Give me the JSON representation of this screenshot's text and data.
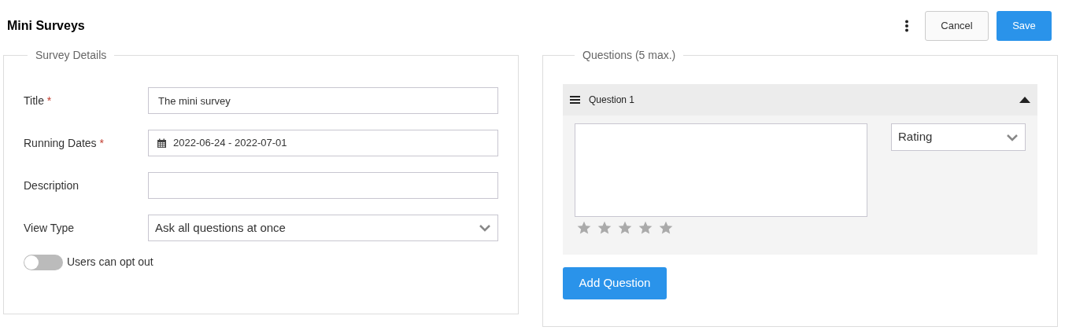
{
  "page_title": "Mini Surveys",
  "actions": {
    "cancel": "Cancel",
    "save": "Save"
  },
  "details": {
    "legend": "Survey Details",
    "fields": [
      {
        "kind": "text",
        "label": "Title",
        "required_mark": "*",
        "value": "The mini survey"
      },
      {
        "kind": "date",
        "label": "Running Dates",
        "required_mark": "*",
        "value": "2022-06-24 - 2022-07-01"
      },
      {
        "kind": "text",
        "label": "Description"
      },
      {
        "kind": "select",
        "label": "View Type",
        "value": "Ask all questions at once"
      }
    ],
    "opt_out": {
      "label": "Users can opt out",
      "on": false
    }
  },
  "questions": {
    "legend": "Questions (5 max.)",
    "items": [
      {
        "title": "Question 1",
        "expanded": true,
        "type": "Rating",
        "stars": 0
      }
    ],
    "add_button": "Add Question"
  }
}
